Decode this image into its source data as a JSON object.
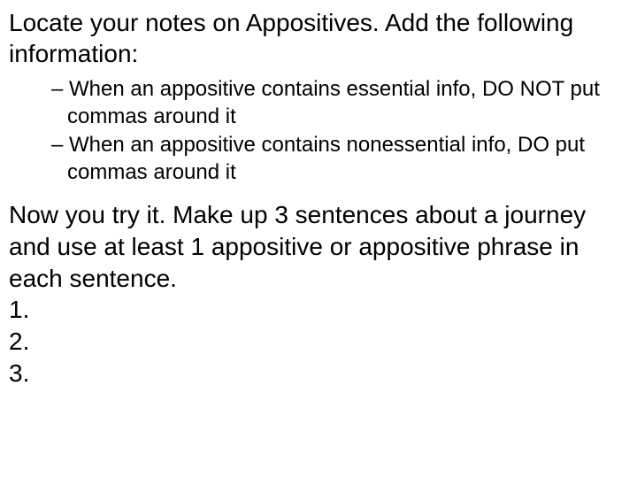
{
  "intro": "Locate your notes on Appositives.  Add the following information:",
  "bullets": [
    "When an appositive contains essential info, DO NOT put commas around it",
    "When an appositive contains nonessential info, DO put commas around it"
  ],
  "dash": "– ",
  "instruction": "Now you try it.  Make up 3 sentences about a journey and use at least 1 appositive or appositive phrase in each sentence.",
  "numbers": [
    "1.",
    "2.",
    "3."
  ]
}
